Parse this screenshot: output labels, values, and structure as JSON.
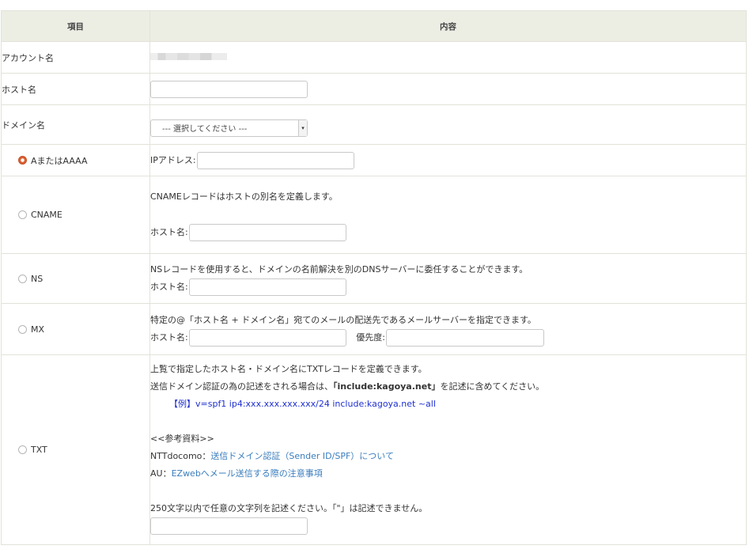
{
  "header": {
    "col_item": "項目",
    "col_content": "内容"
  },
  "account": {
    "label": "アカウント名"
  },
  "host": {
    "label": "ホスト名",
    "value": ""
  },
  "domain": {
    "label": "ドメイン名",
    "selected": "--- 選択してください ---"
  },
  "records": {
    "a": {
      "label": "AまたはAAAA",
      "field_label": "IPアドレス:",
      "value": "",
      "checked": true
    },
    "cname": {
      "label": "CNAME",
      "desc": "CNAMEレコードはホストの別名を定義します。",
      "field_label": "ホスト名:",
      "value": ""
    },
    "ns": {
      "label": "NS",
      "desc": "NSレコードを使用すると、ドメインの名前解決を別のDNSサーバーに委任することができます。",
      "field_label": "ホスト名:",
      "value": ""
    },
    "mx": {
      "label": "MX",
      "desc": "特定の@「ホスト名 + ドメイン名」宛てのメールの配送先であるメールサーバーを指定できます。",
      "host_label": "ホスト名:",
      "host_value": "",
      "priority_label": "優先度:",
      "priority_value": ""
    },
    "txt": {
      "label": "TXT",
      "desc1": "上覧で指定したホスト名・ドメイン名にTXTレコードを定義できます。",
      "desc2_pre": "送信ドメイン認証の為の記述をされる場合は、",
      "desc2_bold": "「include:kagoya.net」",
      "desc2_post": "を記述に含めてください。",
      "example": "【例】v=spf1 ip4:xxx.xxx.xxx.xxx/24 include:kagoya.net ~all",
      "ref_title": "<<参考資料>>",
      "ref1_pre": "NTTdocomo：",
      "ref1_link": "送信ドメイン認証（Sender ID/SPF）について",
      "ref2_pre": "AU：",
      "ref2_link": "EZwebへメール送信する際の注意事項",
      "limit_note": "250文字以内で任意の文字列を記述ください。「\"」は記述できません。",
      "value": ""
    }
  },
  "colors": {
    "header_bg": "#eceee4",
    "radio_checked": "#d9602f",
    "link": "#3a7dbd",
    "example": "#1f2fd0"
  }
}
